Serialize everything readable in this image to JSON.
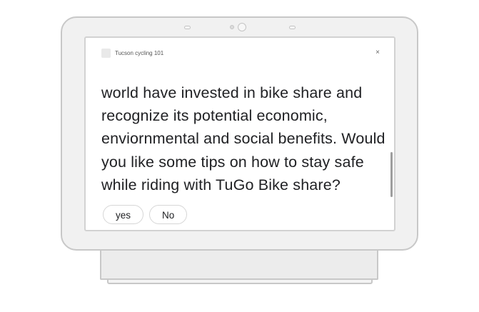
{
  "app": {
    "title": "Tucson cycling 101"
  },
  "message": {
    "text": "world have invested in bike share and recognize its potential economic, enviornmental and social benefits. Would you like some tips on how to stay safe while riding with TuGo Bike share?"
  },
  "suggestions": [
    {
      "label": "yes"
    },
    {
      "label": "No"
    }
  ],
  "close_glyph": "×"
}
